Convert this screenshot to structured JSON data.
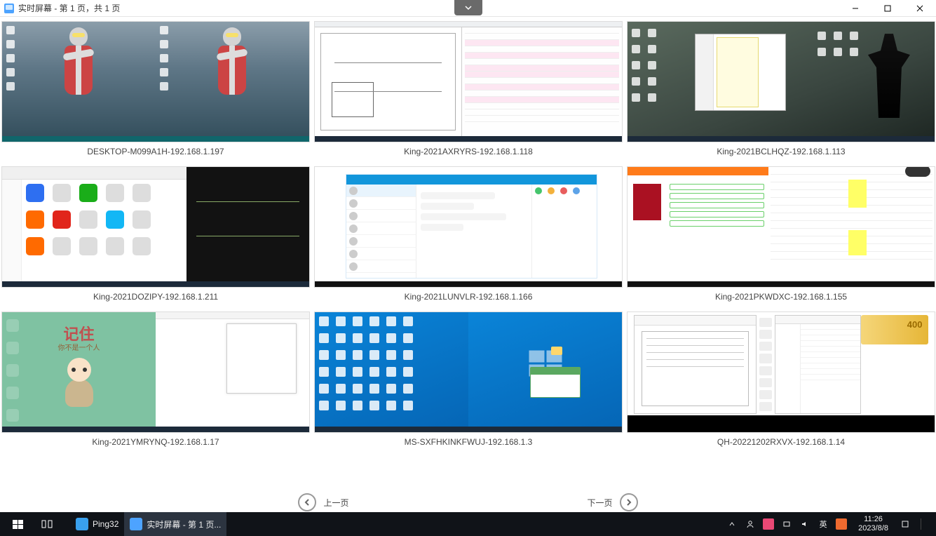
{
  "window": {
    "title": "实时屏幕 - 第 1 页，共 1 页"
  },
  "thumbs": [
    {
      "caption": "DESKTOP-M099A1H-192.168.1.197"
    },
    {
      "caption": "King-2021AXRYRS-192.168.1.118"
    },
    {
      "caption": "King-2021BCLHQZ-192.168.1.113"
    },
    {
      "caption": "King-2021DOZIPY-192.168.1.211"
    },
    {
      "caption": "King-2021LUNVLR-192.168.1.166"
    },
    {
      "caption": "King-2021PKWDXC-192.168.1.155"
    },
    {
      "caption": "King-2021YMRYNQ-192.168.1.17"
    },
    {
      "caption": "MS-SXFHKINKFWUJ-192.168.1.3"
    },
    {
      "caption": "QH-20221202RXVX-192.168.1.14"
    }
  ],
  "thumb6": {
    "big_text": "记住",
    "sub_text": "你不是一个人"
  },
  "thumb8": {
    "gold_num": "400"
  },
  "pager": {
    "prev": "上一页",
    "next": "下一页"
  },
  "taskbar": {
    "app1_label": "Ping32",
    "app2_label": "实时屏幕 - 第 1 页...",
    "ime": "英",
    "time": "11:26",
    "date": "2023/8/8"
  }
}
